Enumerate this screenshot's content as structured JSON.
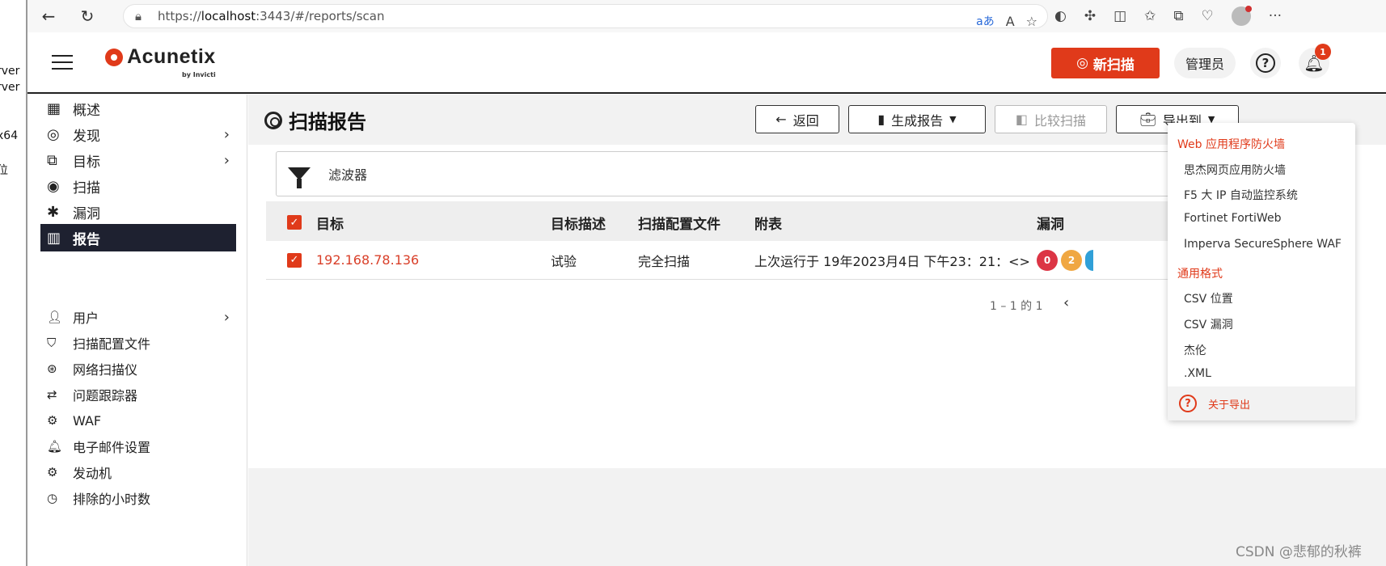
{
  "desktop_strip": [
    "rver",
    "rver",
    "x64",
    "位"
  ],
  "browser": {
    "url_prefix": "https://",
    "url_host": "localhost",
    "url_rest": ":3443/#/reports/scan",
    "back_icon": "←",
    "reload_icon": "↻"
  },
  "header": {
    "brand": "Acunetix",
    "brand_sub": "by Invicti",
    "new_scan_label": "新扫描",
    "admin_label": "管理员",
    "notification_count": "1",
    "accent_color": "#e03a1a"
  },
  "sidebar": {
    "items": [
      {
        "label": "概述",
        "icon": "dashboard-icon"
      },
      {
        "label": "发现",
        "icon": "target-rings-icon"
      },
      {
        "label": "目标",
        "icon": "targets-icon"
      },
      {
        "label": "扫描",
        "icon": "scan-icon"
      },
      {
        "label": "漏洞",
        "icon": "bug-icon"
      },
      {
        "label": "报告",
        "icon": "chart-icon"
      }
    ],
    "settings": [
      {
        "label": "用户",
        "icon": "user-icon"
      },
      {
        "label": "扫描配置文件",
        "icon": "shield-icon"
      },
      {
        "label": "网络扫描仪",
        "icon": "network-icon"
      },
      {
        "label": "问题跟踪器",
        "icon": "tracker-icon"
      },
      {
        "label": "WAF",
        "icon": "chip-icon"
      },
      {
        "label": "电子邮件设置",
        "icon": "bell-icon"
      },
      {
        "label": "发动机",
        "icon": "engine-icon"
      },
      {
        "label": "排除的小时数",
        "icon": "clock-icon"
      }
    ]
  },
  "page": {
    "title": "扫描报告",
    "back_label": "返回",
    "generate_label": "生成报告",
    "compare_label": "比较扫描",
    "export_label": "导出到",
    "filter_label": "滤波器"
  },
  "table": {
    "headers": [
      "目标",
      "目标描述",
      "扫描配置文件",
      "附表",
      "漏洞"
    ],
    "rows": [
      {
        "target": "192.168.78.136",
        "description": "试验",
        "profile": "完全扫描",
        "schedule": "上次运行于 19年2023月4日 下午23：21：<>",
        "vuln_critical": "0",
        "vuln_medium": "2"
      }
    ],
    "pager": "1 – 1 的 1"
  },
  "export_menu": {
    "group_waf": "Web 应用程序防火墙",
    "waf_items": [
      "思杰网页应用防火墙",
      "F5 大 IP 自动监控系统",
      "Fortinet FortiWeb",
      "Imperva SecureSphere WAF"
    ],
    "group_generic": "通用格式",
    "generic_items": [
      "CSV 位置",
      "CSV 漏洞",
      "杰伦",
      ".XML"
    ],
    "about_label": "关于导出"
  },
  "watermark": "CSDN @悲郁的秋裤"
}
